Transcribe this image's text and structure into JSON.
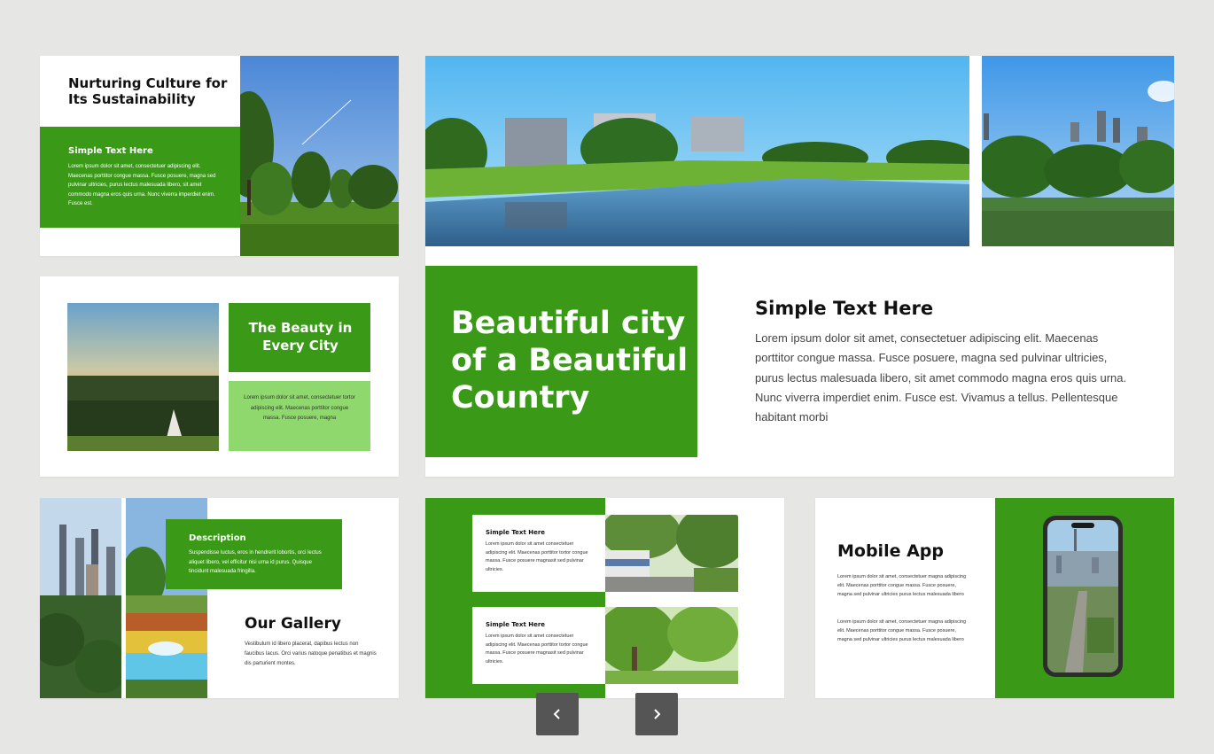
{
  "slide1": {
    "title": "Nurturing Culture for Its Sustainability",
    "box_title": "Simple Text Here",
    "box_body": "Lorem ipsum dolor sit amet, consectetuer adipiscing elit. Maecenas porttitor congue massa. Fusce posuere, magna sed pulvinar ultricies, purus lectus malesuada libero, sit amet commodo magna eros quis urna. Nunc viverra imperdiet enim. Fusce est."
  },
  "slide2": {
    "title": "The Beauty in Every City",
    "body": "Lorem ipsum dolor sit amet, consectetuer tortor adipiscing elit. Maecenas porttitor congue massa. Fusce posuere, magna"
  },
  "slide_main": {
    "headline": "Beautiful city of a Beautiful Country",
    "subtitle": "Simple Text Here",
    "body": "Lorem ipsum dolor sit amet, consectetuer adipiscing elit. Maecenas porttitor congue massa. Fusce posuere, magna sed pulvinar ultricies, purus lectus malesuada libero, sit amet commodo magna eros quis urna. Nunc viverra imperdiet enim. Fusce est. Vivamus a tellus. Pellentesque habitant morbi"
  },
  "slide_gallery": {
    "box_title": "Description",
    "box_body": "Suspendisse luctus, eros in hendrerit lobortis, orci lectus aliquet libero, vel efficitur nisi urna id purus. Quisque tincidunt malesuada fringilla.",
    "title": "Our Gallery",
    "body": "Vestibulum id libero placerat, dapibus lectus non faucibus lacus. Orci varius natoque penatibus et magnis dis parturient montes."
  },
  "slide_cards": {
    "card1_title": "Simple Text Here",
    "card1_body": "Lorem ipsum dolor sit amet consectetuer adipiscing elit. Maecenas porttitor tortor congue massa. Fusce posuere magnasit sed pulvinar ultricies.",
    "card2_title": "Simple Text Here",
    "card2_body": "Lorem ipsum dolor sit amet consectetuer adipiscing elit. Maecenas porttitor tortor congue massa. Fusce posuere magnasit sed pulvinar ultricies."
  },
  "slide_mobile": {
    "title": "Mobile App",
    "body1": "Lorem ipsum dolor sit amet, consectetuer magna adipiscing elit. Maecenas porttitor congue massa. Fusce posuere, magna sed pulvinar ultricies purus lectus malesuada libero",
    "body2": "Lorem ipsum dolor sit amet, consectetuer magna adipiscing elit. Maecenas porttitor congue massa. Fusce posuere, magna sed pulvinar ultricies purus lectus malesuada libero"
  },
  "nav": {
    "prev_icon": "chevron-left-icon",
    "next_icon": "chevron-right-icon"
  },
  "colors": {
    "green": "#3a9a17",
    "light_green": "#8fd86e",
    "background": "#e6e6e5",
    "nav_button": "#555555"
  }
}
